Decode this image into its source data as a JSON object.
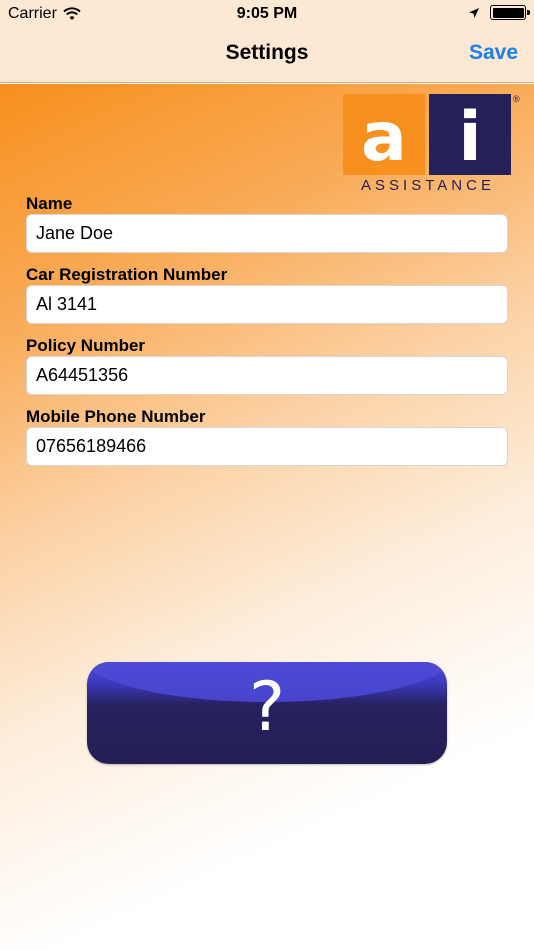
{
  "status_bar": {
    "carrier": "Carrier",
    "time": "9:05 PM"
  },
  "nav": {
    "title": "Settings",
    "save_label": "Save"
  },
  "logo": {
    "letter_left": "a",
    "letter_right": "i",
    "wordmark": "ASSISTANCE",
    "registered_mark": "®"
  },
  "form": {
    "name": {
      "label": "Name",
      "value": "Jane Doe"
    },
    "car_registration": {
      "label": "Car Registration Number",
      "value": "Al 3141"
    },
    "policy_number": {
      "label": "Policy Number",
      "value": "A64451356"
    },
    "mobile_phone": {
      "label": "Mobile Phone Number",
      "value": "07656189466"
    }
  },
  "help_button": {
    "glyph": "?"
  },
  "colors": {
    "accent_blue": "#1a7ff0",
    "brand_orange": "#f7901e",
    "brand_navy": "#24205a"
  }
}
